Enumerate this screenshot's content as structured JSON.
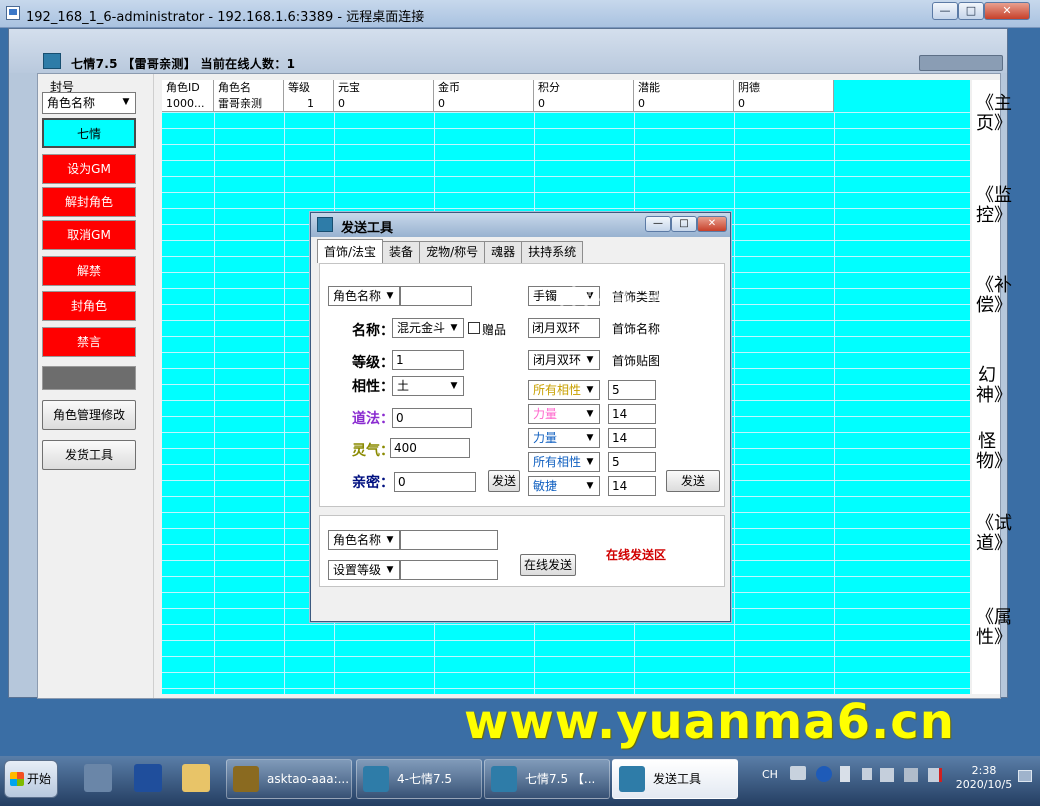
{
  "rdp": {
    "title": "192_168_1_6-administrator - 192.168.1.6:3389 - 远程桌面连接",
    "min": "0",
    "max": "1",
    "close": "r"
  },
  "app": {
    "title": "七情7.5 【雷哥亲测】 当前在线人数：1"
  },
  "left": {
    "ban_label": "封号",
    "combo_value": "角色名称",
    "buttons": [
      "七情",
      "设为GM",
      "解封角色",
      "取消GM",
      "解禁",
      "封角色",
      "禁言"
    ],
    "mgr_button": "角色管理修改",
    "ship_button": "发货工具"
  },
  "grid": {
    "columns": [
      "角色ID",
      "角色名",
      "等级",
      "元宝",
      "金币",
      "积分",
      "潜能",
      "阴德"
    ],
    "rows": [
      [
        "1000...",
        "雷哥亲测",
        "1",
        "0",
        "0",
        "0",
        "0",
        "0"
      ]
    ]
  },
  "rnav": [
    "《主页》",
    "《监控》",
    "《补偿》",
    "幻神》",
    "怪物》",
    "《试道》",
    "《属性》"
  ],
  "dialog": {
    "title": "发送工具",
    "tabs": [
      "首饰/法宝",
      "装备",
      "宠物/称号",
      "魂器",
      "扶持系统"
    ],
    "role_combo": "角色名称",
    "name_label": "名称：",
    "name_value": "混元金斗",
    "gift_label": "赠品",
    "level_label": "等级：",
    "level_value": "1",
    "phase_label": "相性：",
    "phase_value": "土",
    "dao_label": "道法：",
    "dao_value": "0",
    "ling_label": "灵气：",
    "ling_value": "400",
    "qin_label": "亲密：",
    "qin_value": "0",
    "send_label": "发送",
    "jewel_type_combo": "手镯",
    "jewel_type_label": "首饰类型",
    "jewel_name_value": "闭月双环",
    "jewel_name_label": "首饰名称",
    "jewel_img_combo": "闭月双环",
    "jewel_img_label": "首饰贴图",
    "attrs": [
      {
        "name": "所有相性",
        "value": "5",
        "color": "#c8a000"
      },
      {
        "name": "力量",
        "value": "14",
        "color": "#ff66cc"
      },
      {
        "name": "力量",
        "value": "14",
        "color": "#1060c0"
      },
      {
        "name": "所有相性",
        "value": "5",
        "color": "#1060c0"
      },
      {
        "name": "敏捷",
        "value": "14",
        "color": "#1060c0"
      }
    ],
    "send2_label": "发送",
    "online": {
      "role_combo": "角色名称",
      "level_combo": "设置等级",
      "send_label": "在线发送",
      "zone_label": "在线发送区"
    }
  },
  "watermark": "www.yuanma6.cn",
  "watermark2": "雷哥亲测",
  "taskbar": {
    "start": "开始",
    "items": [
      "asktao-aaa:...",
      "4-七情7.5",
      "七情7.5 【...",
      "发送工具"
    ],
    "tray_lang": "CH",
    "clock_time": "2:38",
    "clock_date": "2020/10/5"
  }
}
